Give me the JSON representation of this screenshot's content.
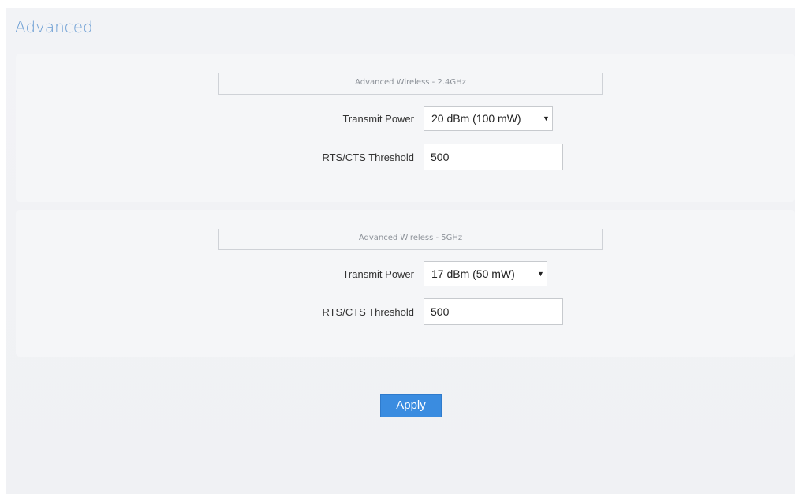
{
  "page": {
    "title": "Advanced"
  },
  "sections": [
    {
      "legend": "Advanced Wireless - 2.4GHz",
      "transmit_power": {
        "label": "Transmit Power",
        "selected": "20 dBm (100 mW)"
      },
      "rts_cts": {
        "label": "RTS/CTS Threshold",
        "value": "500"
      }
    },
    {
      "legend": "Advanced Wireless - 5GHz",
      "transmit_power": {
        "label": "Transmit Power",
        "selected": "17 dBm (50 mW)"
      },
      "rts_cts": {
        "label": "RTS/CTS Threshold",
        "value": "500"
      }
    }
  ],
  "actions": {
    "apply_label": "Apply"
  },
  "icons": {
    "select_arrow": "dropdown-caret-icon"
  },
  "colors": {
    "title": "#6e9fd4",
    "apply_button": "#3a8ce0"
  }
}
